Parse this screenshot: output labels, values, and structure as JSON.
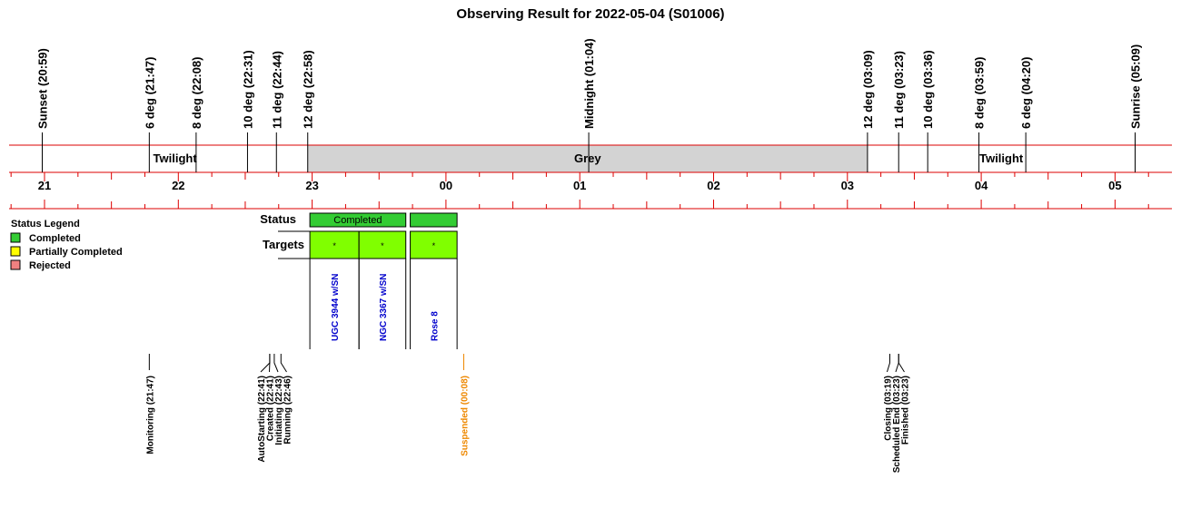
{
  "chart_data": {
    "type": "timeline",
    "title": "Observing Result for 2022-05-04 (S01006)",
    "colors": {
      "axis": "#dd0000",
      "grey_band": "#d3d3d3",
      "completed": "#33cc33",
      "target": "#80ff00",
      "partial": "#ffff00",
      "rejected": "#f08080",
      "target_label": "#0000cc",
      "warning_label": "#ee8800",
      "text": "#000000"
    },
    "axis": {
      "hour_labels": [
        "21",
        "22",
        "23",
        "00",
        "01",
        "02",
        "03",
        "04",
        "05"
      ],
      "hour_values": [
        21,
        22,
        23,
        24,
        25,
        26,
        27,
        28,
        29
      ],
      "range": [
        20.75,
        29.3
      ],
      "minor_tick_minutes": 15
    },
    "sky_events": [
      {
        "label": "Sunset (20:59)",
        "t": 20.983
      },
      {
        "label": "6 deg (21:47)",
        "t": 21.783
      },
      {
        "label": "8 deg (22:08)",
        "t": 22.133
      },
      {
        "label": "10 deg (22:31)",
        "t": 22.517
      },
      {
        "label": "11 deg (22:44)",
        "t": 22.733
      },
      {
        "label": "12 deg (22:58)",
        "t": 22.967
      },
      {
        "label": "Midnight (01:04)",
        "t": 25.067
      },
      {
        "label": "12 deg (03:09)",
        "t": 27.15
      },
      {
        "label": "11 deg (03:23)",
        "t": 27.383
      },
      {
        "label": "10 deg (03:36)",
        "t": 27.6
      },
      {
        "label": "8 deg (03:59)",
        "t": 27.983
      },
      {
        "label": "6 deg (04:20)",
        "t": 28.333
      },
      {
        "label": "Sunrise (05:09)",
        "t": 29.15
      }
    ],
    "sky_bands": [
      {
        "label": "Twilight",
        "start": 20.983,
        "end": 22.967,
        "shaded": false
      },
      {
        "label": "Grey",
        "start": 22.967,
        "end": 27.15,
        "shaded": true
      },
      {
        "label": "Twilight",
        "start": 27.15,
        "end": 29.15,
        "shaded": false
      }
    ],
    "status_row_label": "Status",
    "targets_row_label": "Targets",
    "status_blocks": [
      {
        "label": "Completed",
        "status": "Completed",
        "start": 22.983,
        "end": 23.7
      },
      {
        "label": "",
        "status": "Completed",
        "start": 23.733,
        "end": 24.083
      }
    ],
    "targets": [
      {
        "name": "UGC 3944 w/SN",
        "marker": "*",
        "start": 22.983,
        "end": 23.35
      },
      {
        "name": "NGC 3367 w/SN",
        "marker": "*",
        "start": 23.35,
        "end": 23.7
      },
      {
        "name": "Rose 8",
        "marker": "*",
        "start": 23.733,
        "end": 24.083
      }
    ],
    "legend": {
      "title": "Status Legend",
      "placement": "left",
      "items": [
        {
          "label": "Completed",
          "color": "#33cc33"
        },
        {
          "label": "Partially Completed",
          "color": "#ffff00"
        },
        {
          "label": "Rejected",
          "color": "#f08080"
        }
      ]
    },
    "run_events": [
      {
        "label": "Monitoring (21:47)",
        "t": 21.783,
        "warn": false,
        "group": 0
      },
      {
        "label": "AutoStarting (22:41)",
        "t": 22.683,
        "warn": false,
        "group": 1
      },
      {
        "label": "Created (22:41)",
        "t": 22.683,
        "warn": false,
        "group": 1
      },
      {
        "label": "Initiating (22:43)",
        "t": 22.717,
        "warn": false,
        "group": 1
      },
      {
        "label": "Running (22:46)",
        "t": 22.767,
        "warn": false,
        "group": 1
      },
      {
        "label": "Suspended (00:08)",
        "t": 24.133,
        "warn": true,
        "group": 2
      },
      {
        "label": "Closing (03:19)",
        "t": 27.317,
        "warn": false,
        "group": 3
      },
      {
        "label": "Scheduled End (03:23)",
        "t": 27.383,
        "warn": false,
        "group": 3
      },
      {
        "label": "Finished (03:23)",
        "t": 27.383,
        "warn": false,
        "group": 3
      }
    ]
  }
}
